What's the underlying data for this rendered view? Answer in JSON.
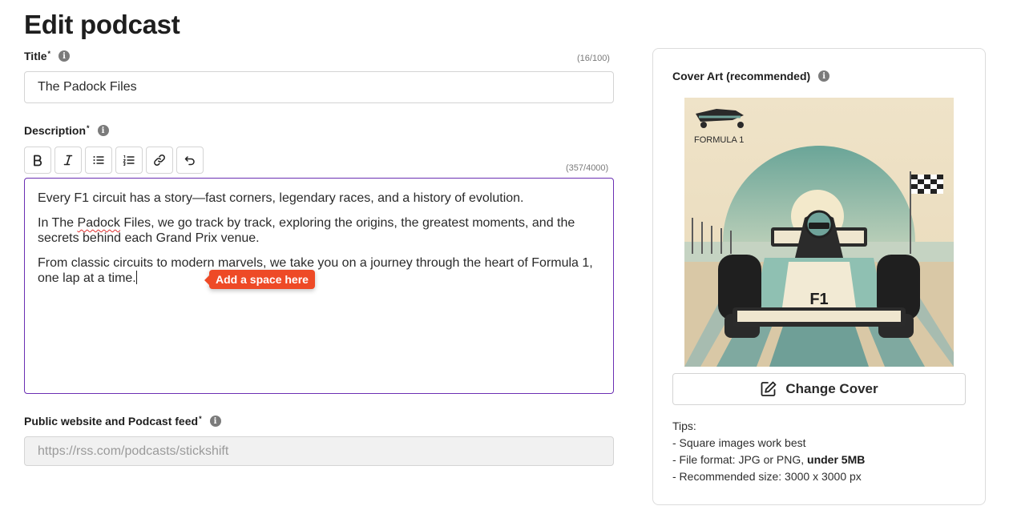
{
  "page": {
    "title": "Edit podcast"
  },
  "title_field": {
    "label": "Title",
    "required_mark": "*",
    "counter": "(16/100)",
    "value": "The Padock Files"
  },
  "description_field": {
    "label": "Description",
    "required_mark": "*",
    "counter": "(357/4000)",
    "toolbar": [
      "bold-icon",
      "italic-icon",
      "bullet-list-icon",
      "numbered-list-icon",
      "link-icon",
      "undo-icon"
    ],
    "paragraph1": "Every F1 circuit has a story—fast corners, legendary races, and a history of evolution.",
    "paragraph2_before": "In The ",
    "paragraph2_misspelled": "Padock",
    "paragraph2_after": " Files, we go track by track, exploring the origins, the greatest moments, and the secrets behind each Grand Prix venue.",
    "paragraph3": "From classic circuits to modern marvels, we take you on a journey through the heart of Formula 1, one lap at a time.",
    "tooltip": "Add a space here",
    "tooltip_color": "#ee4a26",
    "focus_border_color": "#6b2fb3"
  },
  "feed_field": {
    "label": "Public website and Podcast feed",
    "required_mark": "*",
    "placeholder": "https://rss.com/podcasts/stickshift"
  },
  "cover": {
    "label": "Cover Art (recommended)",
    "logo_text": "FORMULA 1",
    "car_number_text": "F1",
    "change_button": "Change Cover",
    "tips_heading": "Tips:",
    "tip1": "- Square images work best",
    "tip2_prefix": "- File format: JPG or PNG, ",
    "tip2_bold": "under 5MB",
    "tip3": "- Recommended size: 3000 x 3000 px"
  }
}
